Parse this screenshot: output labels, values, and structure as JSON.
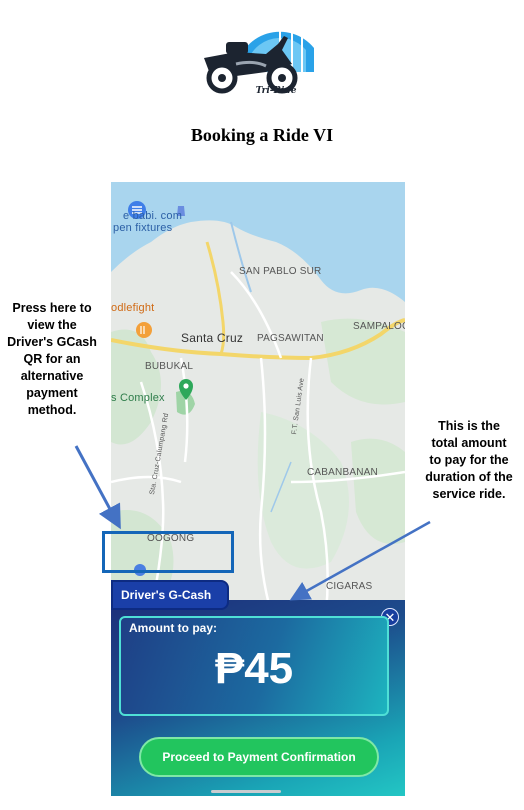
{
  "logo": {
    "text": "Tri-Ride",
    "icon": "motorcycle-sidecar-icon"
  },
  "document": {
    "title": "Booking a Ride VI"
  },
  "map": {
    "labels": {
      "store1": "e babi. com",
      "store2": "pen fixtures",
      "san_pablo_sur": "SAN PABLO SUR",
      "foodfight": "odlefight",
      "santa_cruz": "Santa Cruz",
      "pagsawitan": "PAGSAWITAN",
      "sampaloc": "SAMPALOC",
      "bubukal": "BUBUKAL",
      "sports_complex": "s Complex",
      "cabanban": "CABANBANAN",
      "oogong": "OOGONG",
      "cigaras": "CIGARAS",
      "road1": "Sta. Cruz-Calumpang Rd",
      "road2": "F.T. San Luis Ave"
    }
  },
  "gcash_tab": {
    "label": "Driver's G-Cash"
  },
  "amount_panel": {
    "label": "Amount to pay:",
    "value": "₱45",
    "close_icon": "close-icon"
  },
  "payment_button": {
    "label": "Proceed to Payment Confirmation"
  },
  "callouts": {
    "left": "Press here to view the Driver's GCash QR for an alternative payment method.",
    "right": "This is the total amount to pay for the duration of the service ride."
  },
  "colors": {
    "highlight_box": "#1466b8",
    "arrow": "#4472c4",
    "panel_dark": "#1d2f7a",
    "panel_light": "#23c6c4",
    "button_green": "#22c55e"
  }
}
